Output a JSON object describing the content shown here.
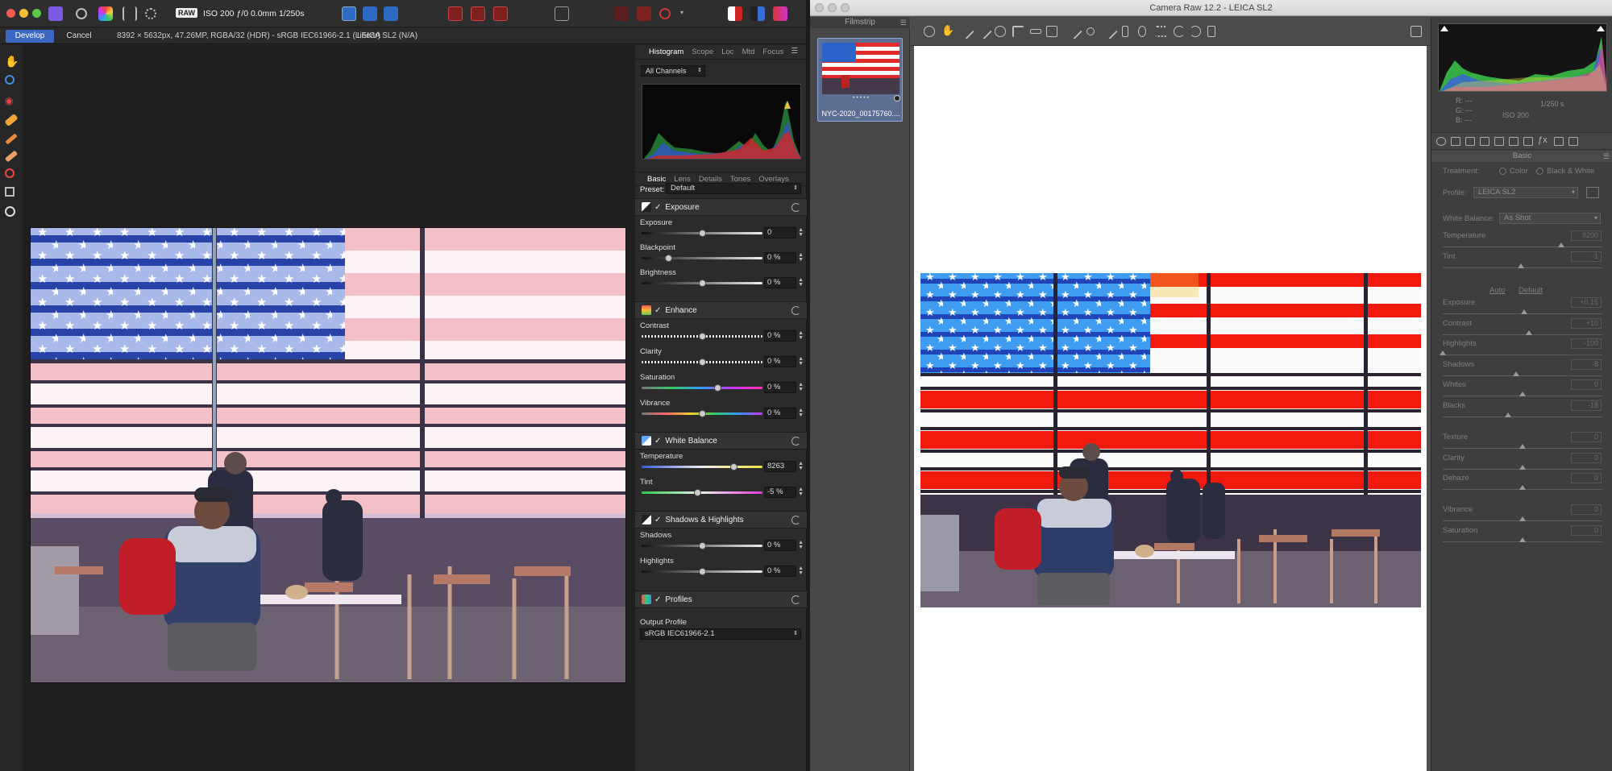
{
  "affinity": {
    "toolbar": {
      "raw_badge": "RAW",
      "exposure_info": "ISO 200 ƒ/0 0.0mm 1/250s"
    },
    "context": {
      "develop_label": "Develop",
      "cancel_label": "Cancel",
      "image_info": "8392 × 5632px, 47.26MP, RGBA/32 (HDR) - sRGB IEC61966-2.1 (Linear)",
      "camera": "LEICA SL2 (N/A)"
    },
    "top_tabs": [
      "Histogram",
      "Scope",
      "Loc",
      "Mtd",
      "Focus"
    ],
    "channels": "All Channels",
    "sub_tabs": [
      "Basic",
      "Lens",
      "Details",
      "Tones",
      "Overlays"
    ],
    "preset": {
      "label": "Preset:",
      "value": "Default"
    },
    "sections": {
      "exposure": "Exposure",
      "enhance": "Enhance",
      "white_balance": "White Balance",
      "shadows_highlights": "Shadows & Highlights",
      "profiles": "Profiles"
    },
    "check": "✓",
    "sliders": {
      "exposure": {
        "label": "Exposure",
        "value": "0",
        "pos": 0.5
      },
      "blackpoint": {
        "label": "Blackpoint",
        "value": "0 %",
        "pos": 0.22
      },
      "brightness": {
        "label": "Brightness",
        "value": "0 %",
        "pos": 0.5
      },
      "contrast": {
        "label": "Contrast",
        "value": "0 %",
        "pos": 0.5
      },
      "clarity": {
        "label": "Clarity",
        "value": "0 %",
        "pos": 0.5
      },
      "saturation": {
        "label": "Saturation",
        "value": "0 %",
        "pos": 0.63
      },
      "vibrance": {
        "label": "Vibrance",
        "value": "0 %",
        "pos": 0.5
      },
      "temperature": {
        "label": "Temperature",
        "value": "8263",
        "pos": 0.76
      },
      "tint": {
        "label": "Tint",
        "value": "-5 %",
        "pos": 0.46
      },
      "shadows": {
        "label": "Shadows",
        "value": "0 %",
        "pos": 0.5
      },
      "highlights": {
        "label": "Highlights",
        "value": "0 %",
        "pos": 0.5
      }
    },
    "output_profile": {
      "label": "Output Profile",
      "value": "sRGB IEC61966-2.1"
    }
  },
  "camera_raw": {
    "window_title": "Camera Raw 12.2  -  LEICA SL2",
    "filmstrip_label": "Filmstrip",
    "thumb_name": "NYC-2020_00175760....",
    "thumb_stars": "• • • • •",
    "info": {
      "r": "R:   ---",
      "g": "G:   ---",
      "b": "B:   ---",
      "shutter": "1/250 s",
      "iso": "ISO 200"
    },
    "basic_header": "Basic",
    "treatment": {
      "label": "Treatment:",
      "color": "Color",
      "bw": "Black & White"
    },
    "profile": {
      "label": "Profile:",
      "value": "LEICA SL2"
    },
    "white_balance": {
      "label": "White Balance:",
      "value": "As Shot"
    },
    "auto_label": "Auto",
    "default_label": "Default",
    "sliders": {
      "temperature": {
        "label": "Temperature",
        "value": "8200",
        "pos": 0.74
      },
      "tint": {
        "label": "Tint",
        "value": "-1",
        "pos": 0.49
      },
      "exposure": {
        "label": "Exposure",
        "value": "+0.15",
        "pos": 0.51
      },
      "contrast": {
        "label": "Contrast",
        "value": "+10",
        "pos": 0.54
      },
      "highlights": {
        "label": "Highlights",
        "value": "-100",
        "pos": 0.0
      },
      "shadows": {
        "label": "Shadows",
        "value": "-8",
        "pos": 0.46
      },
      "whites": {
        "label": "Whites",
        "value": "0",
        "pos": 0.5
      },
      "blacks": {
        "label": "Blacks",
        "value": "-18",
        "pos": 0.41
      },
      "texture": {
        "label": "Texture",
        "value": "0",
        "pos": 0.5
      },
      "clarity": {
        "label": "Clarity",
        "value": "0",
        "pos": 0.5
      },
      "dehaze": {
        "label": "Dehaze",
        "value": "0",
        "pos": 0.5
      },
      "vibrance": {
        "label": "Vibrance",
        "value": "0",
        "pos": 0.5
      },
      "saturation": {
        "label": "Saturation",
        "value": "0",
        "pos": 0.5
      }
    }
  },
  "colors": {
    "accent_blue": "#3c68c4",
    "flag_red": "#e81e10",
    "flag_blue": "#1f6fd6"
  }
}
